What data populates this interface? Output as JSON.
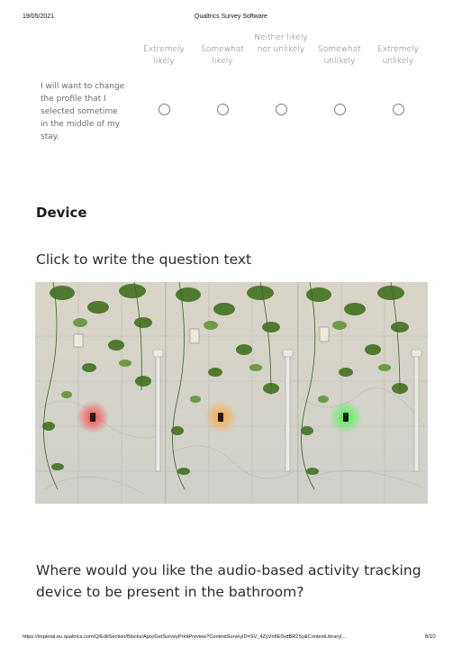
{
  "print_header": {
    "date": "19/05/2021",
    "title": "Qualtrics Survey Software"
  },
  "matrix_question": {
    "scale": [
      "Extremely likely",
      "Somewhat likely",
      "Neither likely nor unlikely",
      "Somewhat unlikely",
      "Extremely unlikely"
    ],
    "statement": "I will want to change the profile that I selected sometime in the middle of my stay."
  },
  "section": {
    "title": "Device"
  },
  "image_question": {
    "text": "Click to write the question text",
    "image_alt": "Three panels of a bathroom wall with plants and shower rail, each showing the device glowing red, orange and green",
    "light_colors": [
      "#ff3b3b",
      "#ffa62b",
      "#33ff3a"
    ]
  },
  "location_question": {
    "text": "Where would you like the audio-based activity tracking device to be present in the bathroom?"
  },
  "print_footer": {
    "url": "https://imperial.eu.qualtrics.com/Q/EditSection/Blocks/Ajax/GetSurveyPrintPreview?ContextSurveyID=SV_4ZyVn8E0vdBR2Sy&ContextLibraryI...",
    "page": "6/10"
  }
}
